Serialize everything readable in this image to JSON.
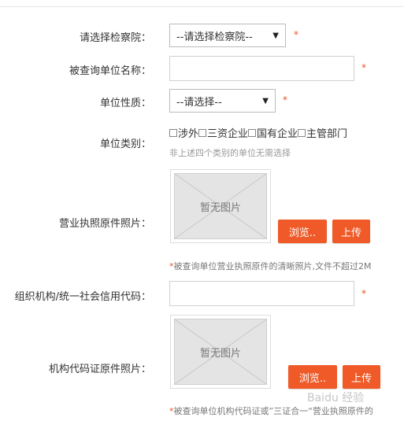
{
  "form": {
    "procuratorate": {
      "label": "请选择检察院：",
      "selected": "--请选择检察院--",
      "required": "*"
    },
    "unit_name": {
      "label": "被查询单位名称：",
      "value": "",
      "required": "*"
    },
    "unit_nature": {
      "label": "单位性质：",
      "selected": "--请选择--",
      "required": "*"
    },
    "unit_category": {
      "label": "单位类别：",
      "options": [
        "涉外",
        "三资企业",
        "国有企业",
        "主管部门"
      ],
      "hint": "非上述四个类别的单位无需选择"
    },
    "license_photo": {
      "label": "营业执照原件照片：",
      "placeholder": "暂无图片",
      "browse_label": "浏览..",
      "upload_label": "上传",
      "note_star": "*",
      "note": "被查询单位营业执照原件的清晰照片,文件不超过2M"
    },
    "credit_code": {
      "label": "组织机构/统一社会信用代码：",
      "value": "",
      "required": "*"
    },
    "org_code_photo": {
      "label": "机构代码证原件照片：",
      "placeholder": "暂无图片",
      "browse_label": "浏览..",
      "upload_label": "上传",
      "note_star": "*",
      "note": "被查询单位机构代码证或”三证合一“营业执照原件的"
    }
  },
  "watermark": "Baidu 经验",
  "colors": {
    "accent": "#ef5a28",
    "required": "#e8521f",
    "hint": "#999999"
  },
  "icons": {
    "select_arrow": "triangle-down-icon",
    "placeholder": "image-placeholder-icon"
  }
}
